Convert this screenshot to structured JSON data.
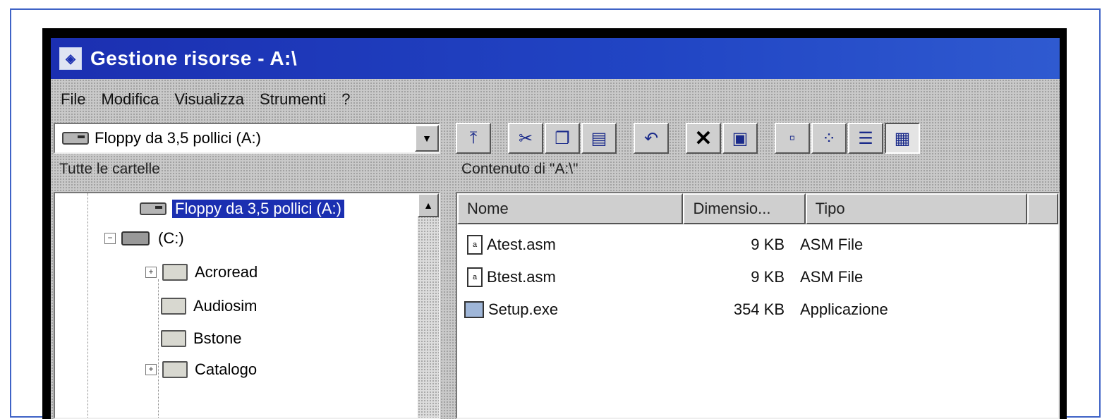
{
  "window": {
    "title": "Gestione risorse - A:\\"
  },
  "menubar": {
    "items": [
      {
        "label": "File"
      },
      {
        "label": "Modifica"
      },
      {
        "label": "Visualizza"
      },
      {
        "label": "Strumenti"
      },
      {
        "label": "?"
      }
    ]
  },
  "address": {
    "value": "Floppy da 3,5 pollici (A:)"
  },
  "toolbar": {
    "buttons": [
      {
        "icon": "up-folder-icon"
      },
      {
        "icon": "cut-icon"
      },
      {
        "icon": "copy-icon"
      },
      {
        "icon": "paste-icon"
      },
      {
        "icon": "undo-icon"
      },
      {
        "icon": "delete-icon"
      },
      {
        "icon": "properties-icon"
      },
      {
        "icon": "large-icons-view-icon"
      },
      {
        "icon": "small-icons-view-icon"
      },
      {
        "icon": "list-view-icon"
      },
      {
        "icon": "details-view-icon"
      }
    ]
  },
  "tree": {
    "header": "Tutte le cartelle",
    "items": [
      {
        "label": "Floppy da 3,5 pollici (A:)",
        "selected": true
      },
      {
        "label": "(C:)"
      },
      {
        "label": "Acroread"
      },
      {
        "label": "Audiosim"
      },
      {
        "label": "Bstone"
      },
      {
        "label": "Catalogo"
      }
    ]
  },
  "contents": {
    "header": "Contenuto di \"A:\\\"",
    "columns": [
      "Nome",
      "Dimensio...",
      "Tipo"
    ],
    "files": [
      {
        "name": "Atest.asm",
        "size": "9 KB",
        "type": "ASM File"
      },
      {
        "name": "Btest.asm",
        "size": "9 KB",
        "type": "ASM File"
      },
      {
        "name": "Setup.exe",
        "size": "354 KB",
        "type": "Applicazione"
      }
    ]
  }
}
